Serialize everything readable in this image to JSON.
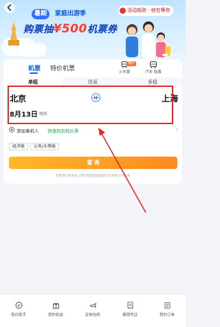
{
  "banner": {
    "pill": "暑期",
    "subtitle": "家庭出游季",
    "headline_prefix": "购票抽",
    "headline_amount": "¥500",
    "headline_suffix": "机票券",
    "activity_badge": "活动规则 · 他在等你"
  },
  "card": {
    "tabs": [
      "机票",
      "特价机票"
    ],
    "modes": [
      {
        "label": "火车票",
        "icon": "train-icon",
        "tag": "特价"
      },
      {
        "label": "汽车 船票",
        "icon": "bus-icon"
      }
    ],
    "trip_tabs": [
      "单程",
      "往返",
      "多程"
    ],
    "from_city": "北京",
    "to_city": "上海",
    "date": "8月13日",
    "date_note": "明天",
    "passenger_label": "添加乘机人",
    "passenger_sub": "快速找到低价票",
    "cabins": [
      "经济舱",
      "公务/头等舱"
    ],
    "search_label": "查 询",
    "footnote": "机票预订服务由上海华程西南国际旅行社有限公司提供"
  },
  "bottom_nav": [
    "低价助手",
    "我的权益",
    "定制包机",
    "报销凭证",
    "我的订单"
  ],
  "colors": {
    "accent": "#0a5ee8",
    "search": "#ff8a1f",
    "highlight": "#e8262a"
  }
}
